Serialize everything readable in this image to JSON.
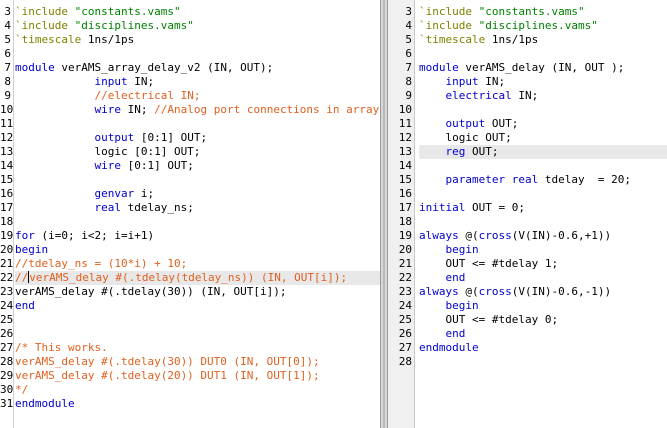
{
  "colors": {
    "keyword": "#0000cc",
    "comment": "#e06020",
    "string": "#008000",
    "directive": "#808000",
    "plain": "#000000",
    "current_line": "#e8e8e8"
  },
  "left": {
    "current_line_index": 19,
    "lines": [
      {
        "n": "3",
        "segs": [
          {
            "t": "`include",
            "c": "directive"
          },
          {
            "t": " "
          },
          {
            "t": "\"constants.vams\"",
            "c": "string"
          }
        ]
      },
      {
        "n": "4",
        "segs": [
          {
            "t": "`include",
            "c": "directive"
          },
          {
            "t": " "
          },
          {
            "t": "\"disciplines.vams\"",
            "c": "string"
          }
        ]
      },
      {
        "n": "5",
        "segs": [
          {
            "t": "`timescale",
            "c": "directive"
          },
          {
            "t": " 1ns/1ps"
          }
        ]
      },
      {
        "n": "6",
        "segs": []
      },
      {
        "n": "7",
        "segs": [
          {
            "t": "module",
            "c": "keyword"
          },
          {
            "t": " verAMS_array_delay_v2 (IN, OUT);"
          }
        ]
      },
      {
        "n": "8",
        "segs": [
          {
            "t": "            "
          },
          {
            "t": "input",
            "c": "keyword"
          },
          {
            "t": " IN;"
          }
        ]
      },
      {
        "n": "9",
        "segs": [
          {
            "t": "            "
          },
          {
            "t": "//electrical IN;",
            "c": "comment"
          }
        ]
      },
      {
        "n": "10",
        "segs": [
          {
            "t": "            "
          },
          {
            "t": "wire",
            "c": "keyword"
          },
          {
            "t": " IN; "
          },
          {
            "t": "//Analog port connections in array",
            "c": "comment"
          }
        ]
      },
      {
        "n": "11",
        "segs": []
      },
      {
        "n": "12",
        "segs": [
          {
            "t": "            "
          },
          {
            "t": "output",
            "c": "keyword"
          },
          {
            "t": " [0:1] OUT;"
          }
        ]
      },
      {
        "n": "13",
        "segs": [
          {
            "t": "            logic [0:1] OUT;"
          }
        ]
      },
      {
        "n": "14",
        "segs": [
          {
            "t": "            "
          },
          {
            "t": "wire",
            "c": "keyword"
          },
          {
            "t": " [0:1] OUT;"
          }
        ]
      },
      {
        "n": "15",
        "segs": []
      },
      {
        "n": "16",
        "segs": [
          {
            "t": "            "
          },
          {
            "t": "genvar",
            "c": "keyword"
          },
          {
            "t": " i;"
          }
        ]
      },
      {
        "n": "17",
        "segs": [
          {
            "t": "            "
          },
          {
            "t": "real",
            "c": "keyword"
          },
          {
            "t": " tdelay_ns;"
          }
        ]
      },
      {
        "n": "18",
        "segs": []
      },
      {
        "n": "19",
        "segs": [
          {
            "t": "for",
            "c": "keyword"
          },
          {
            "t": " (i=0; i<2; i=i+1)"
          }
        ]
      },
      {
        "n": "20",
        "segs": [
          {
            "t": "begin",
            "c": "keyword"
          }
        ]
      },
      {
        "n": "21",
        "segs": [
          {
            "t": "//tdelay_ns = (10*i) + 10;",
            "c": "comment"
          }
        ]
      },
      {
        "n": "22",
        "segs": [
          {
            "t": "//",
            "c": "comment"
          },
          {
            "caret": true
          },
          {
            "t": "verAMS_delay #(.tdelay(tdelay_ns)) (IN, OUT[i]);",
            "c": "comment"
          }
        ]
      },
      {
        "n": "23",
        "segs": [
          {
            "t": "verAMS_delay #(.tdelay(30)) (IN, OUT[i]);"
          }
        ]
      },
      {
        "n": "24",
        "segs": [
          {
            "t": "end",
            "c": "keyword"
          }
        ]
      },
      {
        "n": "25",
        "segs": []
      },
      {
        "n": "26",
        "segs": []
      },
      {
        "n": "27",
        "segs": [
          {
            "t": "/* This works.",
            "c": "comment"
          }
        ]
      },
      {
        "n": "28",
        "segs": [
          {
            "t": "verAMS_delay #(.tdelay(30)) DUT0 (IN, OUT[0]);",
            "c": "comment"
          }
        ]
      },
      {
        "n": "29",
        "segs": [
          {
            "t": "verAMS_delay #(.tdelay(20)) DUT1 (IN, OUT[1]);",
            "c": "comment"
          }
        ]
      },
      {
        "n": "30",
        "segs": [
          {
            "t": "*/",
            "c": "comment"
          }
        ]
      },
      {
        "n": "31",
        "segs": [
          {
            "t": "endmodule",
            "c": "keyword"
          }
        ]
      }
    ]
  },
  "right": {
    "current_line_index": 10,
    "lines": [
      {
        "n": "3",
        "segs": [
          {
            "t": "`include",
            "c": "directive"
          },
          {
            "t": " "
          },
          {
            "t": "\"constants.vams\"",
            "c": "string"
          }
        ]
      },
      {
        "n": "4",
        "segs": [
          {
            "t": "`include",
            "c": "directive"
          },
          {
            "t": " "
          },
          {
            "t": "\"disciplines.vams\"",
            "c": "string"
          }
        ]
      },
      {
        "n": "5",
        "segs": [
          {
            "t": "`timescale",
            "c": "directive"
          },
          {
            "t": " 1ns/1ps"
          }
        ]
      },
      {
        "n": "6",
        "segs": []
      },
      {
        "n": "7",
        "segs": [
          {
            "t": "module",
            "c": "keyword"
          },
          {
            "t": " verAMS_delay (IN, OUT );"
          }
        ]
      },
      {
        "n": "8",
        "segs": [
          {
            "t": "    "
          },
          {
            "t": "input",
            "c": "keyword"
          },
          {
            "t": " IN;"
          }
        ]
      },
      {
        "n": "9",
        "segs": [
          {
            "t": "    "
          },
          {
            "t": "electrical",
            "c": "keyword"
          },
          {
            "t": " IN;"
          }
        ]
      },
      {
        "n": "10",
        "segs": []
      },
      {
        "n": "11",
        "segs": [
          {
            "t": "    "
          },
          {
            "t": "output",
            "c": "keyword"
          },
          {
            "t": " OUT;"
          }
        ]
      },
      {
        "n": "12",
        "segs": [
          {
            "t": "    logic OUT;"
          }
        ]
      },
      {
        "n": "13",
        "segs": [
          {
            "t": "    "
          },
          {
            "t": "reg",
            "c": "keyword"
          },
          {
            "t": " OUT;"
          }
        ]
      },
      {
        "n": "14",
        "segs": []
      },
      {
        "n": "15",
        "segs": [
          {
            "t": "    "
          },
          {
            "t": "parameter",
            "c": "keyword"
          },
          {
            "t": " "
          },
          {
            "t": "real",
            "c": "keyword"
          },
          {
            "t": " tdelay  = 20;"
          }
        ]
      },
      {
        "n": "16",
        "segs": []
      },
      {
        "n": "17",
        "segs": [
          {
            "t": "initial",
            "c": "keyword"
          },
          {
            "t": " OUT = 0;"
          }
        ]
      },
      {
        "n": "18",
        "segs": []
      },
      {
        "n": "19",
        "segs": [
          {
            "t": "always",
            "c": "keyword"
          },
          {
            "t": " @("
          },
          {
            "t": "cross",
            "c": "keyword"
          },
          {
            "t": "(V(IN)-0.6,+1))"
          }
        ]
      },
      {
        "n": "20",
        "segs": [
          {
            "t": "    "
          },
          {
            "t": "begin",
            "c": "keyword"
          }
        ]
      },
      {
        "n": "21",
        "segs": [
          {
            "t": "    OUT <= #tdelay 1;"
          }
        ]
      },
      {
        "n": "22",
        "segs": [
          {
            "t": "    "
          },
          {
            "t": "end",
            "c": "keyword"
          }
        ]
      },
      {
        "n": "23",
        "segs": [
          {
            "t": "always",
            "c": "keyword"
          },
          {
            "t": " @("
          },
          {
            "t": "cross",
            "c": "keyword"
          },
          {
            "t": "(V(IN)-0.6,-1))"
          }
        ]
      },
      {
        "n": "24",
        "segs": [
          {
            "t": "    "
          },
          {
            "t": "begin",
            "c": "keyword"
          }
        ]
      },
      {
        "n": "25",
        "segs": [
          {
            "t": "    OUT <= #tdelay 0;"
          }
        ]
      },
      {
        "n": "26",
        "segs": [
          {
            "t": "    "
          },
          {
            "t": "end",
            "c": "keyword"
          }
        ]
      },
      {
        "n": "27",
        "segs": [
          {
            "t": "endmodule",
            "c": "keyword"
          }
        ]
      },
      {
        "n": "28",
        "segs": []
      }
    ]
  }
}
